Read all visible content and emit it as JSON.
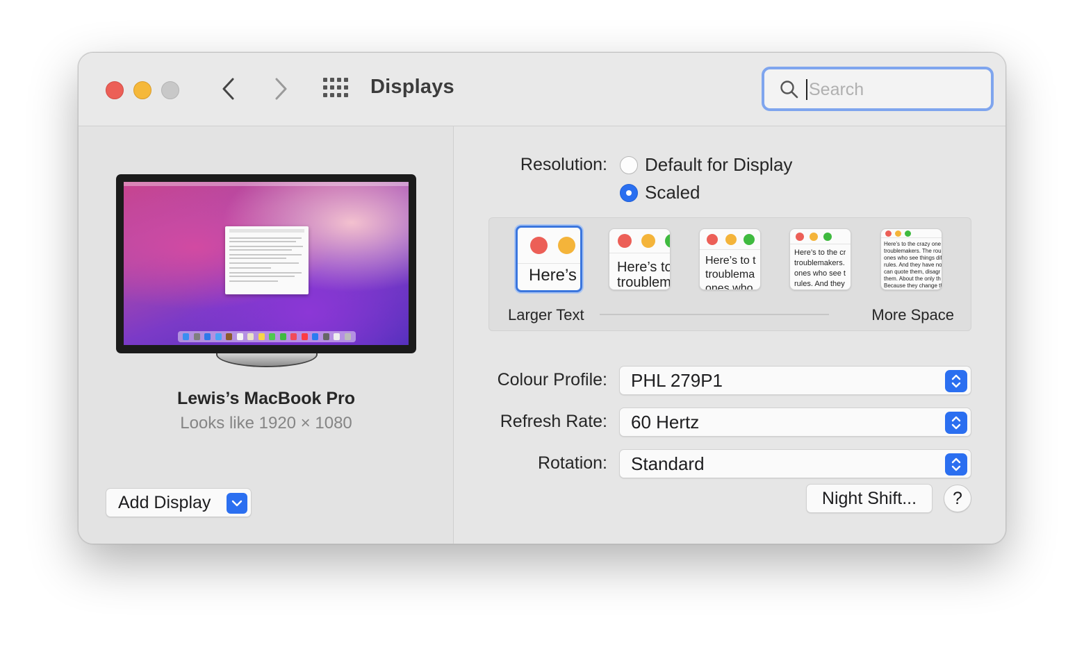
{
  "window": {
    "title": "Displays",
    "traffic_lights": [
      "close-icon",
      "minimize-icon",
      "zoom-icon"
    ],
    "nav": {
      "back_icon": "chevron-left-icon",
      "forward_icon": "chevron-right-icon",
      "grid_icon": "grid-icon"
    }
  },
  "search": {
    "placeholder": "Search",
    "value": "",
    "icon": "search-icon"
  },
  "display": {
    "name": "Lewis’s MacBook Pro",
    "resolution_text": "Looks like 1920 × 1080",
    "add_button_label": "Add Display"
  },
  "resolution": {
    "label": "Resolution:",
    "options": [
      {
        "label": "Default for Display",
        "selected": false
      },
      {
        "label": "Scaled",
        "selected": true
      }
    ]
  },
  "scaling": {
    "left_label": "Larger Text",
    "right_label": "More Space",
    "options": [
      {
        "text_lines": [
          "Here’s"
        ],
        "selected": true
      },
      {
        "text_lines": [
          "Here’s to",
          "troublem"
        ],
        "selected": false
      },
      {
        "text_lines": [
          "Here’s to t",
          "troublema",
          "ones who"
        ],
        "selected": false
      },
      {
        "text_lines": [
          "Here’s to the cr",
          "troublemakers.",
          "ones who see t",
          "rules. And they"
        ],
        "selected": false
      },
      {
        "text_lines": [
          "Here’s to the crazy one",
          "troublemakers. The rou",
          "ones who see things dif",
          "rules. And they have no",
          "can quote them, disagr",
          "them. About the only th",
          "Because they change th"
        ],
        "selected": false
      }
    ]
  },
  "colour_profile": {
    "label": "Colour Profile:",
    "value": "PHL 279P1"
  },
  "refresh_rate": {
    "label": "Refresh Rate:",
    "value": "60 Hertz"
  },
  "rotation": {
    "label": "Rotation:",
    "value": "Standard"
  },
  "buttons": {
    "night_shift": "Night Shift...",
    "help": "?"
  },
  "colors": {
    "accent": "#2b6ff0",
    "close": "#ec5f57",
    "minimize": "#f5b83a",
    "zoom_disabled": "#c8c8c8",
    "focus_ring": "#7fa5ee"
  }
}
